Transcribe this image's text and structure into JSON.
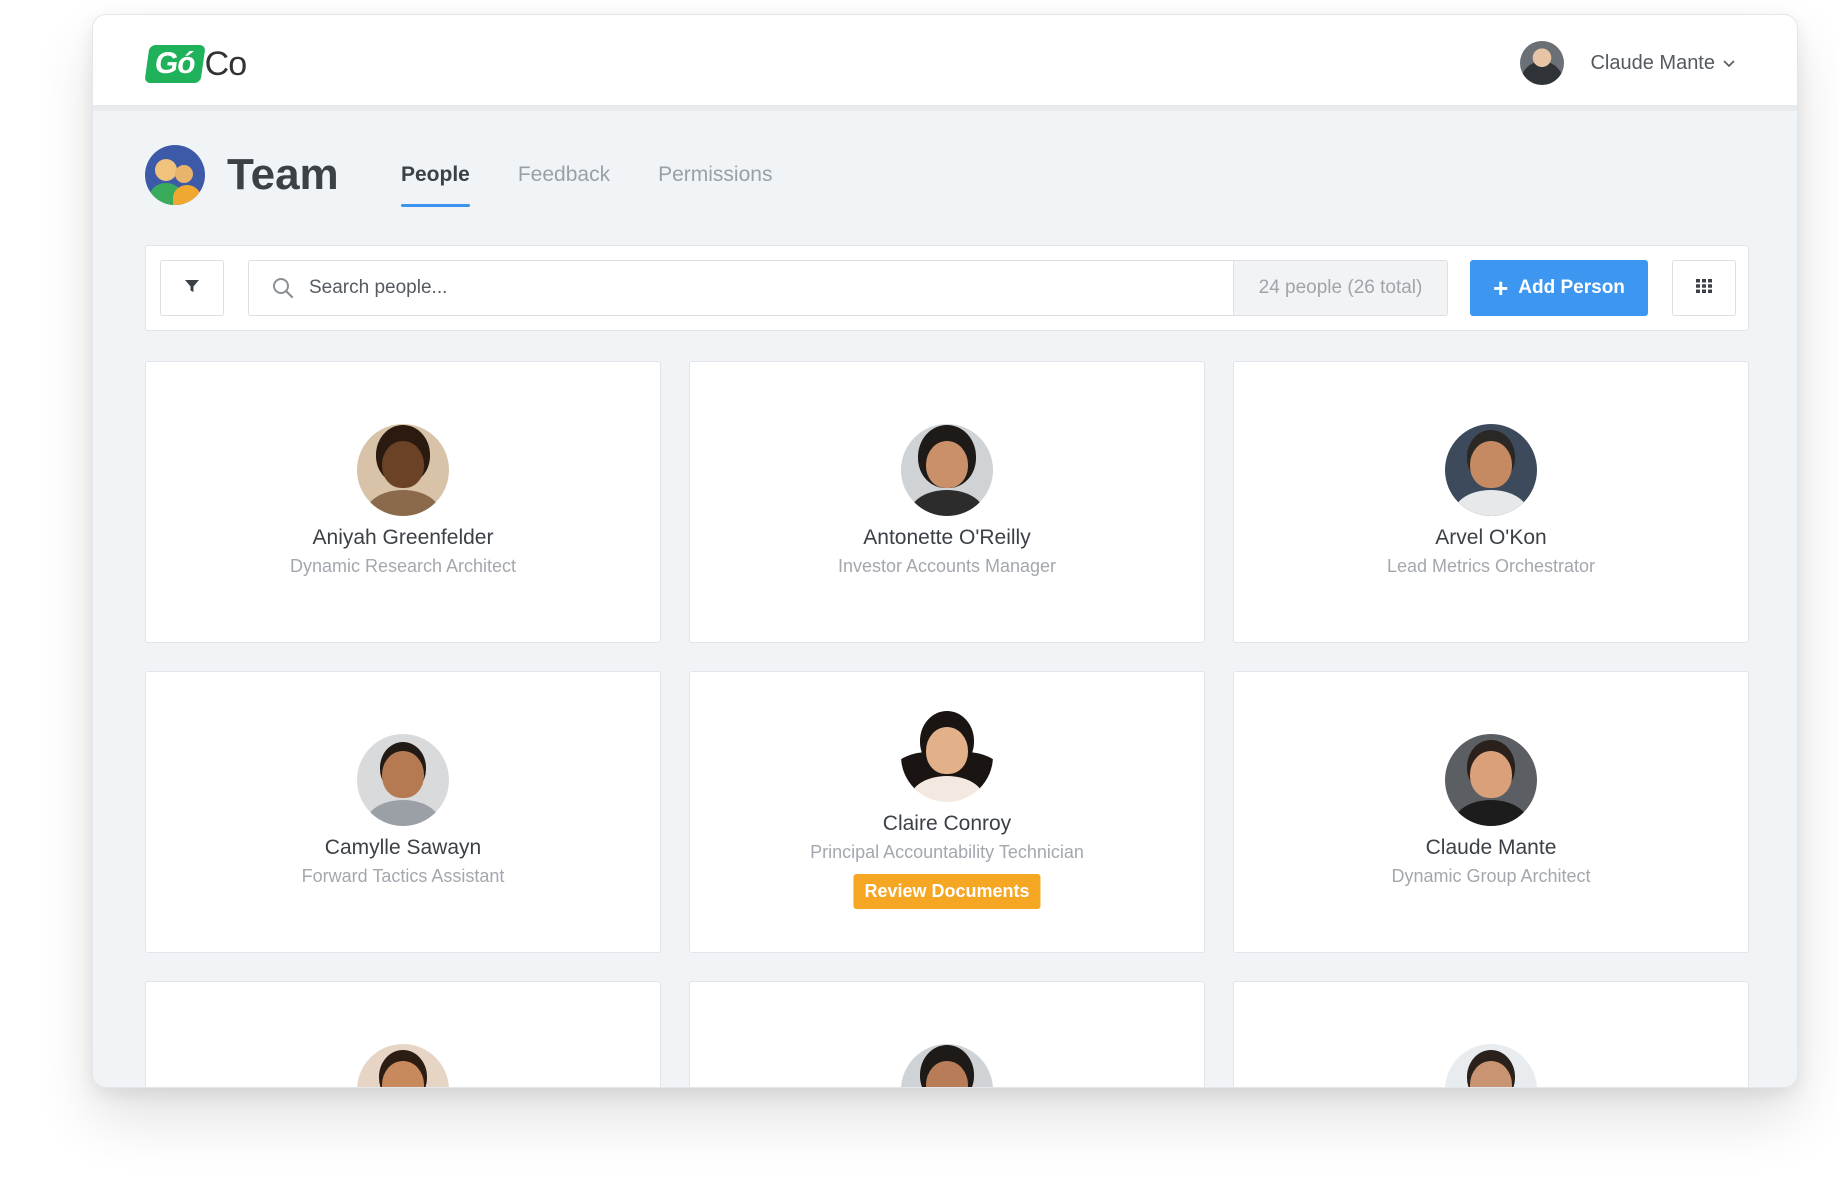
{
  "app": {
    "logo_text_box": "Gó",
    "logo_text_rest": "Co"
  },
  "user": {
    "name": "Claude Mante"
  },
  "header": {
    "title": "Team",
    "tabs": [
      {
        "label": "People",
        "active": true
      },
      {
        "label": "Feedback",
        "active": false
      },
      {
        "label": "Permissions",
        "active": false
      }
    ]
  },
  "toolbar": {
    "search_placeholder": "Search people...",
    "count": "24 people (26 total)",
    "add_label": "Add Person"
  },
  "colors": {
    "accent": "#3d97f0",
    "brand": "#1fb25a",
    "badge": "#f5a623"
  },
  "people": [
    {
      "name": "Aniyah Greenfelder",
      "role": "Dynamic Research Architect",
      "badge": ""
    },
    {
      "name": "Antonette O'Reilly",
      "role": "Investor Accounts Manager",
      "badge": ""
    },
    {
      "name": "Arvel O'Kon",
      "role": "Lead Metrics Orchestrator",
      "badge": ""
    },
    {
      "name": "Camylle Sawayn",
      "role": "Forward Tactics Assistant",
      "badge": ""
    },
    {
      "name": "Claire Conroy",
      "role": "Principal Accountability Technician",
      "badge": "Review Documents"
    },
    {
      "name": "Claude Mante",
      "role": "Dynamic Group Architect",
      "badge": ""
    }
  ]
}
